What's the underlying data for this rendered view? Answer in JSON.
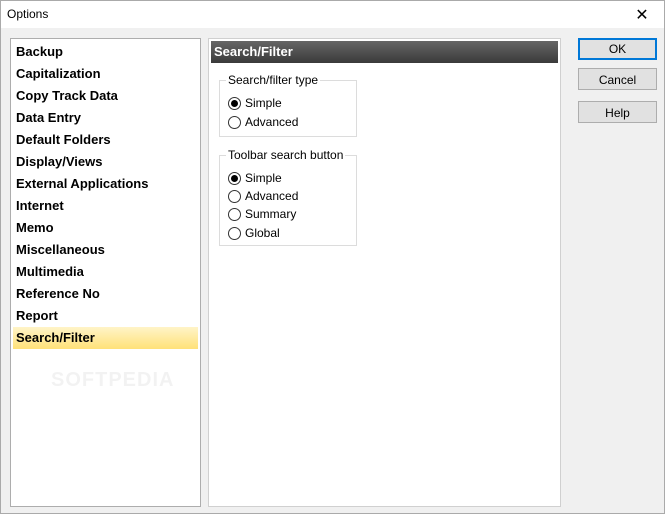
{
  "window": {
    "title": "Options"
  },
  "nav": {
    "items": [
      {
        "label": "Backup"
      },
      {
        "label": "Capitalization"
      },
      {
        "label": "Copy Track Data"
      },
      {
        "label": "Data Entry"
      },
      {
        "label": "Default Folders"
      },
      {
        "label": "Display/Views"
      },
      {
        "label": "External Applications"
      },
      {
        "label": "Internet"
      },
      {
        "label": "Memo"
      },
      {
        "label": "Miscellaneous"
      },
      {
        "label": "Multimedia"
      },
      {
        "label": "Reference No"
      },
      {
        "label": "Report"
      },
      {
        "label": "Search/Filter",
        "selected": true
      }
    ]
  },
  "watermark": "SOFTPEDIA",
  "panel": {
    "header": "Search/Filter",
    "group1": {
      "label": "Search/filter type",
      "options": [
        {
          "label": "Simple",
          "checked": true
        },
        {
          "label": "Advanced",
          "checked": false
        }
      ]
    },
    "group2": {
      "label": "Toolbar search button",
      "options": [
        {
          "label": "Simple",
          "checked": true
        },
        {
          "label": "Advanced",
          "checked": false
        },
        {
          "label": "Summary",
          "checked": false
        },
        {
          "label": "Global",
          "checked": false
        }
      ]
    }
  },
  "buttons": {
    "ok": "OK",
    "cancel": "Cancel",
    "help": "Help"
  },
  "icons": {
    "close": "close-icon"
  }
}
